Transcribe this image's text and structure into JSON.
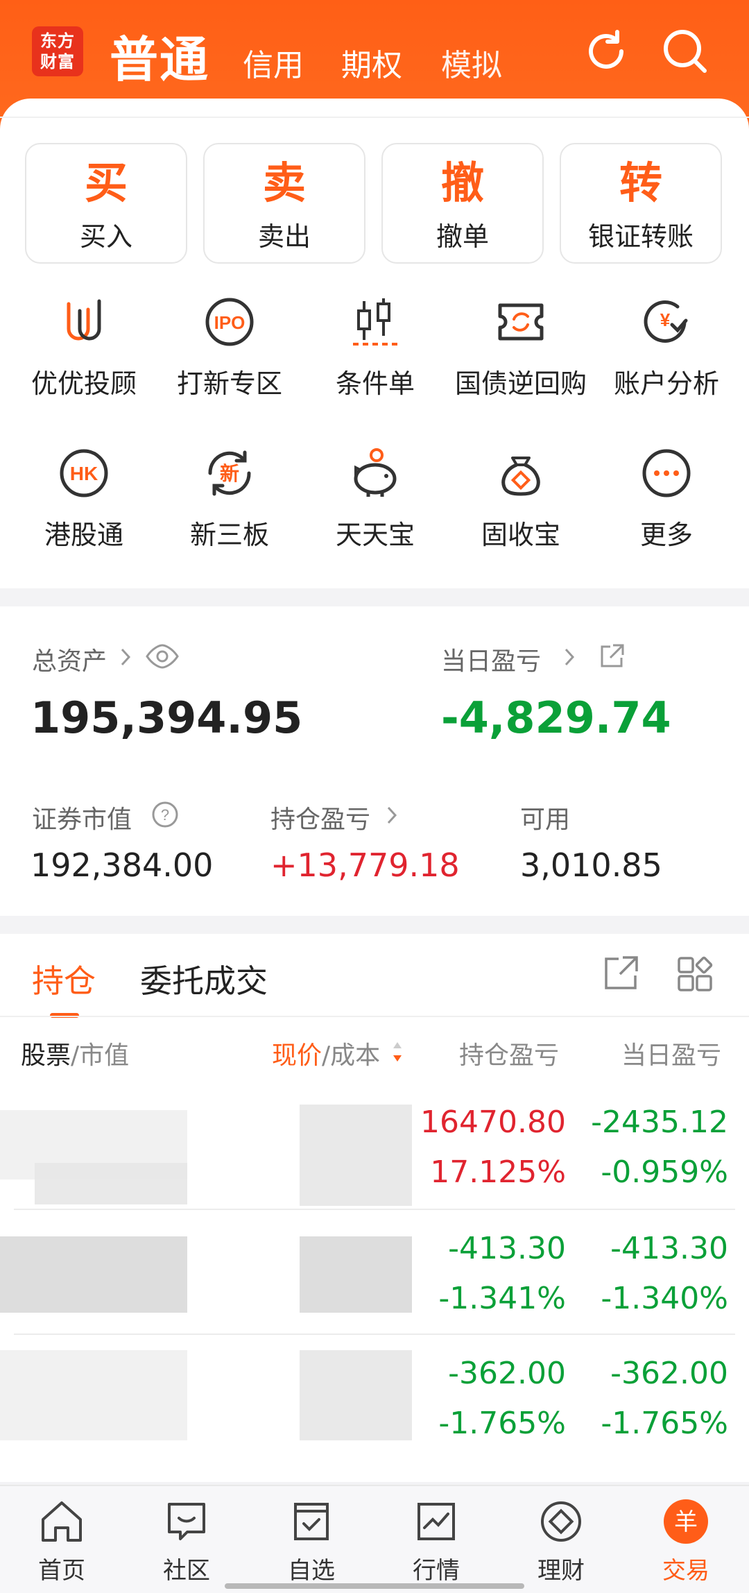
{
  "header": {
    "logo_line1": "东方",
    "logo_line2": "财富",
    "tabs": [
      {
        "label": "普通"
      },
      {
        "label": "信用"
      },
      {
        "label": "期权"
      },
      {
        "label": "模拟"
      }
    ],
    "accent_color": "#ff5f16"
  },
  "actions": [
    {
      "big": "买",
      "label": "买入"
    },
    {
      "big": "卖",
      "label": "卖出"
    },
    {
      "big": "撤",
      "label": "撤单"
    },
    {
      "big": "转",
      "label": "银证转账"
    }
  ],
  "grid": [
    {
      "label": "优优投顾",
      "icon": "uu-advisor-icon"
    },
    {
      "label": "打新专区",
      "icon": "ipo-icon"
    },
    {
      "label": "条件单",
      "icon": "candlestick-icon"
    },
    {
      "label": "国债逆回购",
      "icon": "bond-repo-icon"
    },
    {
      "label": "账户分析",
      "icon": "account-analysis-icon"
    },
    {
      "label": "港股通",
      "icon": "hk-icon"
    },
    {
      "label": "新三板",
      "icon": "new-third-board-icon"
    },
    {
      "label": "天天宝",
      "icon": "piggy-bank-icon"
    },
    {
      "label": "固收宝",
      "icon": "money-bag-icon"
    },
    {
      "label": "更多",
      "icon": "more-icon"
    }
  ],
  "assets": {
    "total_label": "总资产",
    "total_value": "195,394.95",
    "daily_label": "当日盈亏",
    "daily_value": "-4,829.74",
    "market_label": "证券市值",
    "market_value": "192,384.00",
    "position_pl_label": "持仓盈亏",
    "position_pl_value": "+13,779.18",
    "available_label": "可用",
    "available_value": "3,010.85"
  },
  "holdings": {
    "tab_active": "持仓",
    "tab_inactive": "委托成交",
    "col_stock": "股票",
    "col_stock_sub": "/市值",
    "col_price": "现价",
    "col_price_sub": "/成本",
    "col_pl": "持仓盈亏",
    "col_daily": "当日盈亏",
    "rows": [
      {
        "pl": "16470.80",
        "pl_pct": "17.125%",
        "daily": "-2435.12",
        "daily_pct": "-0.959%"
      },
      {
        "pl": "-413.30",
        "pl_pct": "-1.341%",
        "daily": "-413.30",
        "daily_pct": "-1.340%"
      },
      {
        "pl": "-362.00",
        "pl_pct": "-1.765%",
        "daily": "-362.00",
        "daily_pct": "-1.765%"
      }
    ]
  },
  "nav": [
    {
      "label": "首页",
      "icon": "home-icon"
    },
    {
      "label": "社区",
      "icon": "community-icon"
    },
    {
      "label": "自选",
      "icon": "watchlist-icon"
    },
    {
      "label": "行情",
      "icon": "market-chart-icon"
    },
    {
      "label": "理财",
      "icon": "finance-icon"
    },
    {
      "label": "交易",
      "icon": "trade-icon"
    }
  ]
}
